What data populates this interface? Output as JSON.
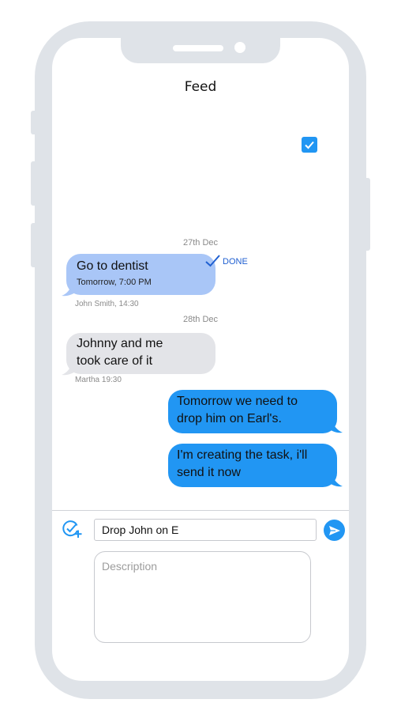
{
  "header": {
    "title": "Feed"
  },
  "messages": [
    {
      "date": "27th Dec",
      "text": "Go to dentist",
      "subtitle": "Tomorrow, 7:00 PM",
      "status": "DONE",
      "author_meta": "John Smith, 14:30"
    },
    {
      "date": "28th Dec",
      "line1": "Johnny and me",
      "line2": "took care of it",
      "author_meta": "Martha 19:30"
    },
    {
      "line1": "Tomorrow we need to",
      "line2": "drop him on Earl's."
    },
    {
      "line1": "I'm creating the task, i'll",
      "line2": "send it now"
    }
  ],
  "composer": {
    "title_value": "Drop John on E",
    "description_placeholder": "Description"
  },
  "colors": {
    "accent": "#2196f3",
    "task_bubble": "#a9c6f7",
    "incoming_bubble": "#e3e4e8",
    "phone_frame": "#dfe3e8"
  },
  "icons": {
    "checkbox": "checkbox-checked-icon",
    "done": "checkmark-icon",
    "add_task": "add-task-icon",
    "send": "send-icon"
  }
}
